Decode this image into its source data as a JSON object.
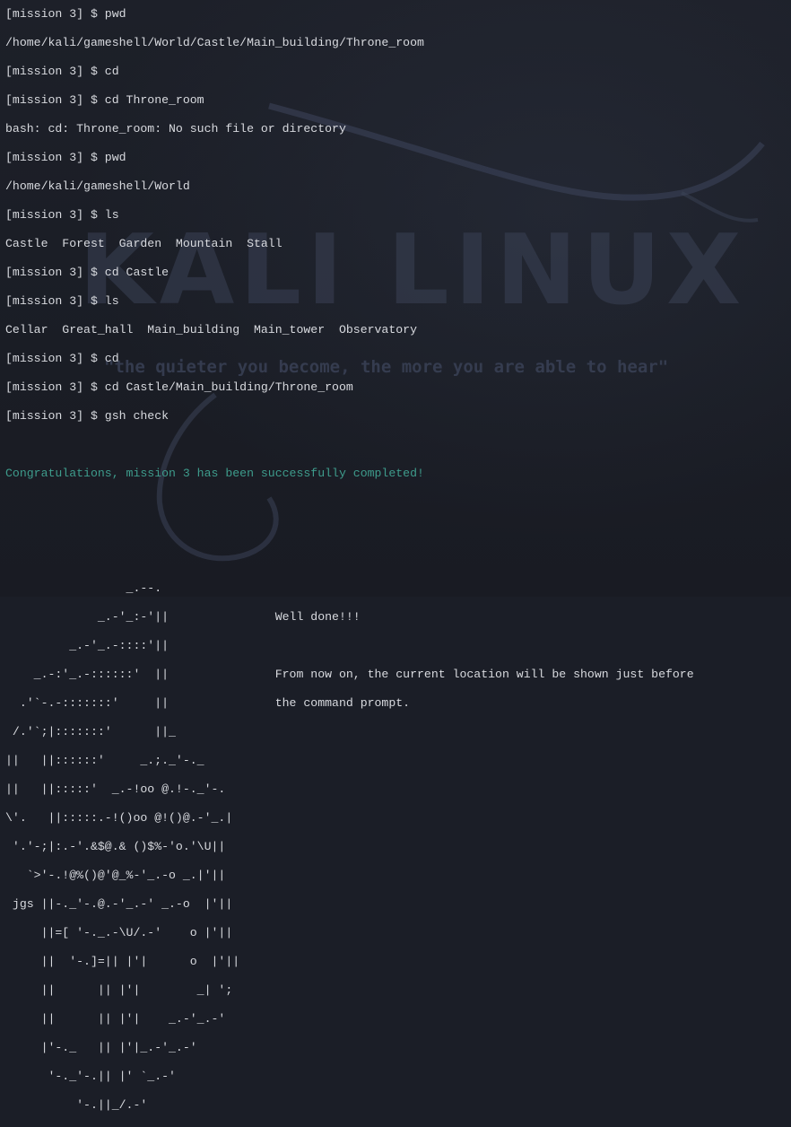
{
  "wallpaper": {
    "title": "KALI LINUX",
    "quote": "\"the quieter you become, the more you are able to hear\""
  },
  "terminal": {
    "lines": [
      "[mission 3] $ pwd",
      "/home/kali/gameshell/World/Castle/Main_building/Throne_room",
      "[mission 3] $ cd",
      "[mission 3] $ cd Throne_room",
      "bash: cd: Throne_room: No such file or directory",
      "[mission 3] $ pwd",
      "/home/kali/gameshell/World",
      "[mission 3] $ ls",
      "Castle  Forest  Garden  Mountain  Stall",
      "[mission 3] $ cd Castle",
      "[mission 3] $ ls",
      "Cellar  Great_hall  Main_building  Main_tower  Observatory",
      "[mission 3] $ cd",
      "[mission 3] $ cd Castle/Main_building/Throne_room",
      "[mission 3] $ gsh check",
      "",
      "Congratulations, mission 3 has been successfully completed!",
      "",
      "",
      "",
      "                 _.--.",
      "             _.-'_:-'||               Well done!!!",
      "         _.-'_.-::::'||",
      "    _.-:'_.-::::::'  ||               From now on, the current location will be shown just before",
      "  .'`-.-:::::::'     ||               the command prompt.",
      " /.'`;|:::::::'      ||_",
      "||   ||::::::'     _.;._'-._",
      "||   ||:::::'  _.-!oo @.!-._'-.",
      "\\'.   ||:::::.-!()oo @!()@.-'_.|",
      " '.'-;|:.-'.&$@.& ()$%-'o.'\\U||",
      "   `>'-.!@%()@'@_%-'_.-o _.|'||",
      " jgs ||-._'-.@.-'_.-' _.-o  |'||",
      "     ||=[ '-._.-\\U/.-'    o |'||",
      "     ||  '-.]=|| |'|      o  |'||",
      "     ||      || |'|        _| ';",
      "     ||      || |'|    _.-'_.-'",
      "     |'-._   || |'|_.-'_.-'",
      "      '-._'-.|| |' `_.-'",
      "          '-.||_/.-'"
    ]
  }
}
